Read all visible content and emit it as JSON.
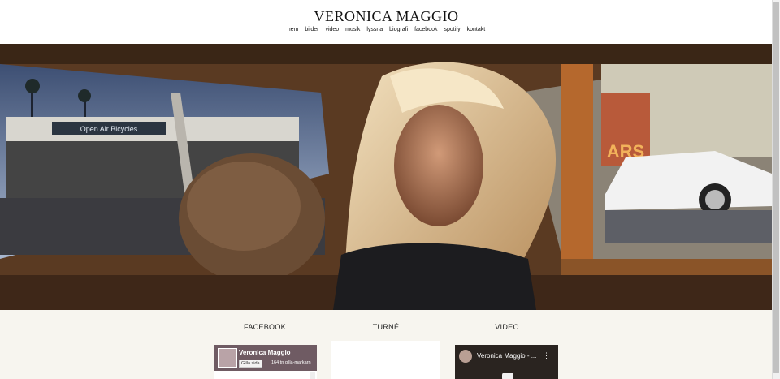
{
  "site": {
    "title": "VERONICA MAGGIO"
  },
  "nav": {
    "items": [
      "hem",
      "bilder",
      "video",
      "musik",
      "lyssna",
      "biografi",
      "facebook",
      "spotify",
      "kontakt"
    ]
  },
  "hero": {
    "sign_text": "Open Air Bicycles",
    "sign_text_right": "ARS"
  },
  "sections": {
    "facebook": "FACEBOOK",
    "tour": "TURNÉ",
    "video": "VIDEO"
  },
  "facebook_widget": {
    "page_name": "Veronica Maggio",
    "like_label": "Gilla sida",
    "likes": "164 tn gilla-markarn"
  },
  "video_widget": {
    "title": "Veronica Maggio - ...",
    "menu": "⋮"
  },
  "colors": {
    "background": "#ffffff",
    "lower_background": "#f7f5ef",
    "text": "#111111"
  }
}
